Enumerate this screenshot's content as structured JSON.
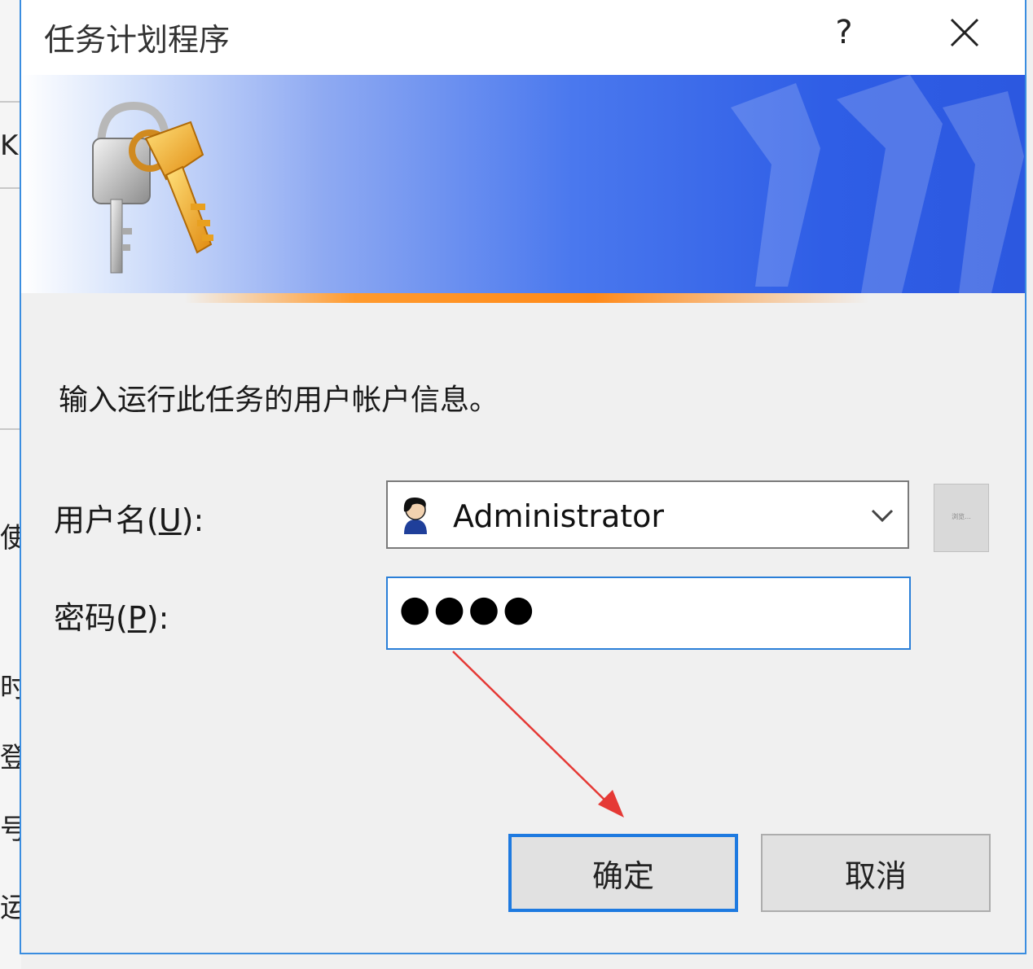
{
  "background_window": {
    "fragments": [
      "K",
      "使",
      "时",
      "登",
      "号",
      "运"
    ]
  },
  "dialog": {
    "title": "任务计划程序",
    "help_label": "?",
    "close_icon": "close-icon"
  },
  "banner": {
    "icon": "keys-icon"
  },
  "form": {
    "prompt": "输入运行此任务的用户帐户信息。",
    "username_label_prefix": "用户名(",
    "username_label_key": "U",
    "username_label_suffix": "):",
    "username_value": "Administrator",
    "password_label_prefix": "密码(",
    "password_label_key": "P",
    "password_label_suffix": "):",
    "password_value": "●●●●",
    "browse_label": "浏览..."
  },
  "buttons": {
    "ok": "确定",
    "cancel": "取消"
  },
  "colors": {
    "accent": "#1e7ae0",
    "annotation_arrow": "#e53935",
    "banner_start": "#ffffff",
    "banner_end": "#2c58e0"
  }
}
